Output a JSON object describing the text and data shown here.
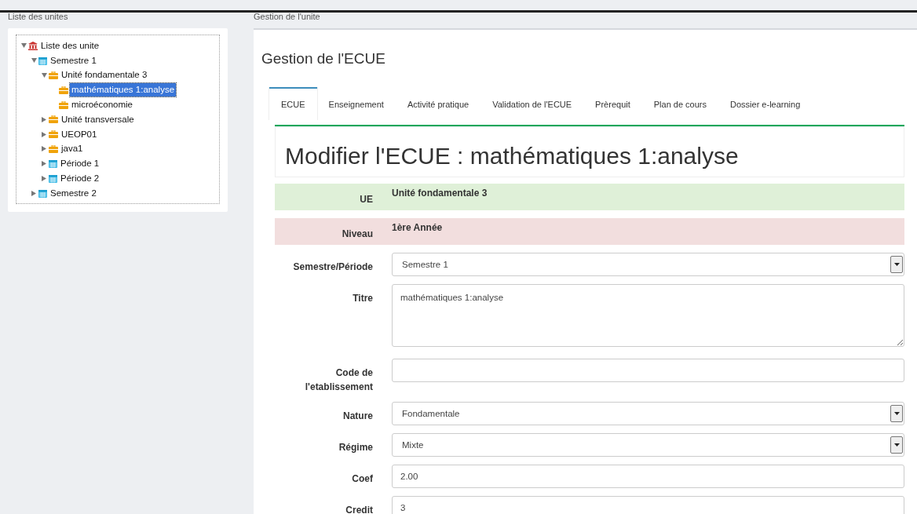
{
  "left_panel": {
    "title": "Liste des unites",
    "tree": [
      {
        "label": "Liste des unite",
        "kind": "root",
        "expanded": true,
        "selected": false,
        "children": [
          {
            "label": "Semestre 1",
            "kind": "period",
            "expanded": true,
            "selected": false,
            "children": [
              {
                "label": "Unité fondamentale 3",
                "kind": "unit",
                "expanded": true,
                "selected": false,
                "children": [
                  {
                    "label": "mathématiques 1:analyse",
                    "kind": "unit",
                    "selected": true
                  },
                  {
                    "label": "microéconomie",
                    "kind": "unit",
                    "selected": false
                  }
                ]
              },
              {
                "label": "Unité transversale",
                "kind": "unit",
                "expanded": false,
                "selected": false
              },
              {
                "label": "UEOP01",
                "kind": "unit",
                "expanded": false,
                "selected": false
              },
              {
                "label": "java1",
                "kind": "unit",
                "expanded": false,
                "selected": false
              },
              {
                "label": "Période 1",
                "kind": "period",
                "expanded": false,
                "selected": false
              },
              {
                "label": "Période 2",
                "kind": "period",
                "expanded": false,
                "selected": false
              }
            ]
          },
          {
            "label": "Semestre 2",
            "kind": "period",
            "expanded": false,
            "selected": false
          }
        ]
      }
    ]
  },
  "main_panel": {
    "title": "Gestion de l'unite",
    "heading": "Gestion de l'ECUE",
    "tabs": [
      {
        "label": "ECUE",
        "selected": true
      },
      {
        "label": "Enseignement",
        "selected": false
      },
      {
        "label": "Activité pratique",
        "selected": false
      },
      {
        "label": "Validation de l'ECUE",
        "selected": false
      },
      {
        "label": "Prèrequit",
        "selected": false
      },
      {
        "label": "Plan de cours",
        "selected": false
      },
      {
        "label": "Dossier e-learning",
        "selected": false
      }
    ],
    "form_title": "Modifier l'ECUE : mathématiques 1:analyse",
    "fields": [
      {
        "kind": "static",
        "label": "UE",
        "value": "Unité fondamentale 3",
        "color": "#dff0d8"
      },
      {
        "kind": "static",
        "label": "Niveau",
        "value": "1ère Année",
        "color": "#f2dede"
      },
      {
        "kind": "select",
        "label": "Semestre/Période",
        "value": "Semestre 1"
      },
      {
        "kind": "textarea",
        "label": "Titre",
        "value": "mathématiques 1:analyse"
      },
      {
        "kind": "input",
        "label": "Code de l'etablissement"
      },
      {
        "kind": "select",
        "label": "Nature",
        "value": "Fondamentale"
      },
      {
        "kind": "select",
        "label": "Régime",
        "value": "Mixte"
      },
      {
        "kind": "input",
        "label": "Coef",
        "value": "2.00"
      },
      {
        "kind": "input",
        "label": "Credit",
        "value": "3"
      }
    ]
  }
}
